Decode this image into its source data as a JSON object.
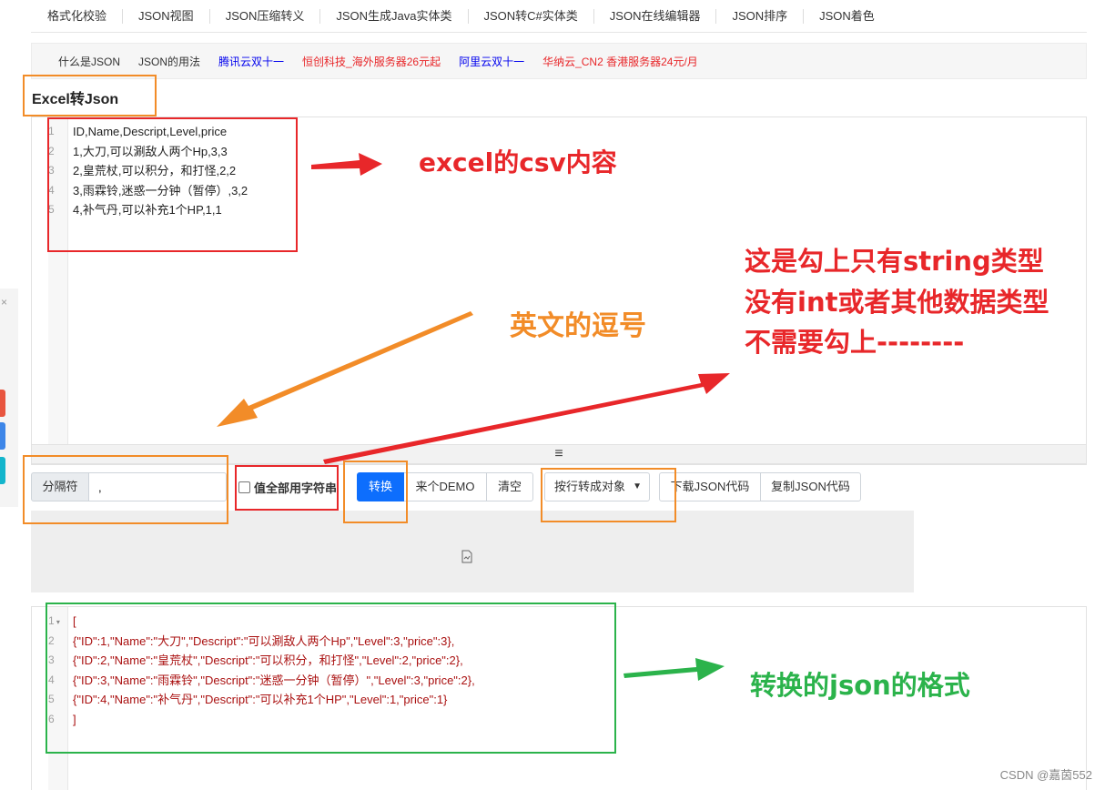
{
  "topnav": [
    "格式化校验",
    "JSON视图",
    "JSON压缩转义",
    "JSON生成Java实体类",
    "JSON转C#实体类",
    "JSON在线编辑器",
    "JSON排序",
    "JSON着色"
  ],
  "links": [
    {
      "text": "什么是JSON",
      "color": "#333333"
    },
    {
      "text": "JSON的用法",
      "color": "#333333"
    },
    {
      "text": "腾讯云双十一",
      "color": "#0000ee"
    },
    {
      "text": "恒创科技_海外服务器26元起",
      "color": "#e8272a"
    },
    {
      "text": "阿里云双十一",
      "color": "#0000ee"
    },
    {
      "text": "华纳云_CN2 香港服务器24元/月",
      "color": "#e8272a"
    }
  ],
  "page_title": "Excel转Json",
  "input_lines": [
    {
      "num": "1",
      "code": "ID,Name,Descript,Level,price"
    },
    {
      "num": "2",
      "code": "1,大刀,可以涮敌人两个Hp,3,3"
    },
    {
      "num": "3",
      "code": "2,皇荒杖,可以积分，和打怪,2,2"
    },
    {
      "num": "4",
      "code": "3,雨霖铃,迷惑一分钟（暂停）,3,2"
    },
    {
      "num": "5",
      "code": "4,补气丹,可以补充1个HP,1,1"
    }
  ],
  "resizer_glyph": "≡",
  "toolbar": {
    "separator_label": "分隔符",
    "separator_value": ",",
    "all_string_label": "值全部用字符串",
    "convert_label": "转换",
    "demo_label": "来个DEMO",
    "clear_label": "清空",
    "mode_select": "按行转成对象",
    "download_label": "下载JSON代码",
    "copy_label": "复制JSON代码"
  },
  "output_lines": [
    {
      "num": "1",
      "code": "[",
      "fold": true
    },
    {
      "num": "2",
      "code": "{\"ID\":1,\"Name\":\"大刀\",\"Descript\":\"可以涮敌人两个Hp\",\"Level\":3,\"price\":3},"
    },
    {
      "num": "3",
      "code": "{\"ID\":2,\"Name\":\"皇荒杖\",\"Descript\":\"可以积分，和打怪\",\"Level\":2,\"price\":2},"
    },
    {
      "num": "4",
      "code": "{\"ID\":3,\"Name\":\"雨霖铃\",\"Descript\":\"迷惑一分钟（暂停）\",\"Level\":3,\"price\":2},"
    },
    {
      "num": "5",
      "code": "{\"ID\":4,\"Name\":\"补气丹\",\"Descript\":\"可以补充1个HP\",\"Level\":1,\"price\":1}"
    },
    {
      "num": "6",
      "code": "]"
    }
  ],
  "annotations": {
    "csv_content": "excel的csv内容",
    "comma": "英文的逗号",
    "string_note_1": "这是勾上只有string类型",
    "string_note_2": "没有int或者其他数据类型",
    "string_note_3": "不需要勾上--------",
    "json_format": "转换的json的格式"
  },
  "side_close": "×",
  "watermark": "CSDN @嘉茵552",
  "colors": {
    "red": "#e8272a",
    "orange": "#f28c28",
    "green": "#2bb34b",
    "primary": "#0d6efd"
  }
}
